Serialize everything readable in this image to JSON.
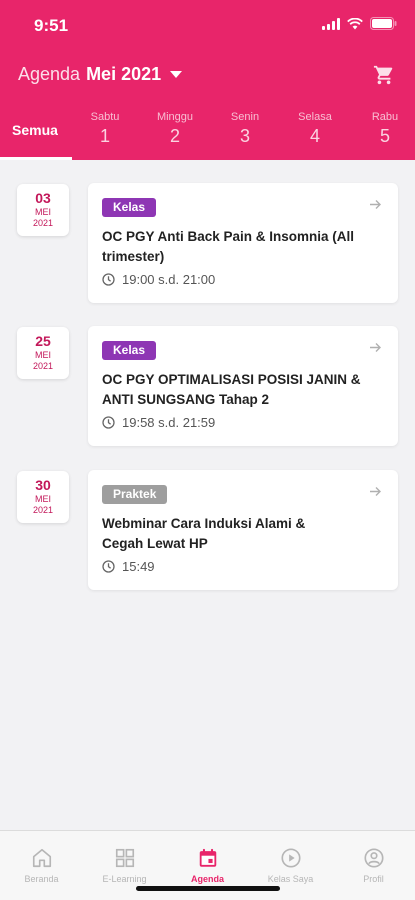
{
  "status": {
    "time": "9:51"
  },
  "header": {
    "title_prefix": "Agenda",
    "title_month": "Mei 2021",
    "cart_icon": "shopping-cart-icon"
  },
  "tabs": {
    "all_label": "Semua",
    "days": [
      {
        "name": "Sabtu",
        "num": "1"
      },
      {
        "name": "Minggu",
        "num": "2"
      },
      {
        "name": "Senin",
        "num": "3"
      },
      {
        "name": "Selasa",
        "num": "4"
      },
      {
        "name": "Rabu",
        "num": "5"
      }
    ]
  },
  "events": [
    {
      "day": "03",
      "month": "MEI",
      "year": "2021",
      "category": "Kelas",
      "title": "OC PGY Anti Back Pain & Insomnia (All trimester)",
      "time": "19:00 s.d. 21:00"
    },
    {
      "day": "25",
      "month": "MEI",
      "year": "2021",
      "category": "Kelas",
      "title": "OC PGY OPTIMALISASI POSISI JANIN & ANTI SUNGSANG Tahap 2",
      "time": "19:58 s.d. 21:59"
    },
    {
      "day": "30",
      "month": "MEI",
      "year": "2021",
      "category": "Praktek",
      "title": "Webminar Cara Induksi Alami & Cegah Lewat HP",
      "time": "15:49"
    }
  ],
  "colors": {
    "brand": "#e8256a",
    "badge_kelas": "#8e36b4",
    "badge_praktek": "#9e9e9e",
    "date_text": "#c3185a"
  },
  "bottom_nav": [
    {
      "label": "Beranda",
      "icon": "home-icon",
      "active": false
    },
    {
      "label": "E-Learning",
      "icon": "grid-icon",
      "active": false
    },
    {
      "label": "Agenda",
      "icon": "calendar-icon",
      "active": true
    },
    {
      "label": "Kelas Saya",
      "icon": "play-circle-icon",
      "active": false
    },
    {
      "label": "Profil",
      "icon": "profile-icon",
      "active": false
    }
  ]
}
